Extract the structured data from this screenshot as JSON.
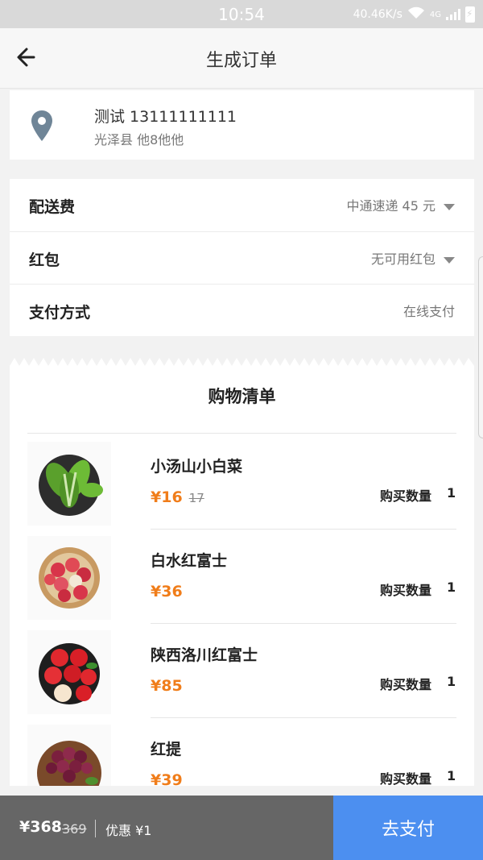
{
  "status_bar": {
    "time": "10:54",
    "network_speed": "40.46K/s",
    "network_type": "4G"
  },
  "header": {
    "title": "生成订单"
  },
  "address": {
    "name_phone": "测试 13111111111",
    "detail": "光泽县 他8他他"
  },
  "options": {
    "delivery": {
      "label": "配送费",
      "value": "中通速递 45 元"
    },
    "red_packet": {
      "label": "红包",
      "value": "无可用红包"
    },
    "payment": {
      "label": "支付方式",
      "value": "在线支付"
    }
  },
  "shopping_list": {
    "title": "购物清单",
    "qty_label": "购买数量",
    "items": [
      {
        "name": "小汤山小白菜",
        "price": "¥16",
        "original_price": "17",
        "qty": "1",
        "image": "bok-choy-plate"
      },
      {
        "name": "白水红富士",
        "price": "¥36",
        "original_price": "",
        "qty": "1",
        "image": "apple-basket"
      },
      {
        "name": "陕西洛川红富士",
        "price": "¥85",
        "original_price": "",
        "qty": "1",
        "image": "red-apples-plate"
      },
      {
        "name": "红提",
        "price": "¥39",
        "original_price": "",
        "qty": "1",
        "image": "red-grapes"
      }
    ]
  },
  "footer": {
    "total": "¥368",
    "original_total": "369",
    "discount": "优惠 ¥1",
    "pay_button": "去支付"
  },
  "colors": {
    "accent_price": "#f07d1a",
    "pay_button": "#4c8ff0",
    "summary_bg": "#666666",
    "pin": "#6f8597"
  }
}
